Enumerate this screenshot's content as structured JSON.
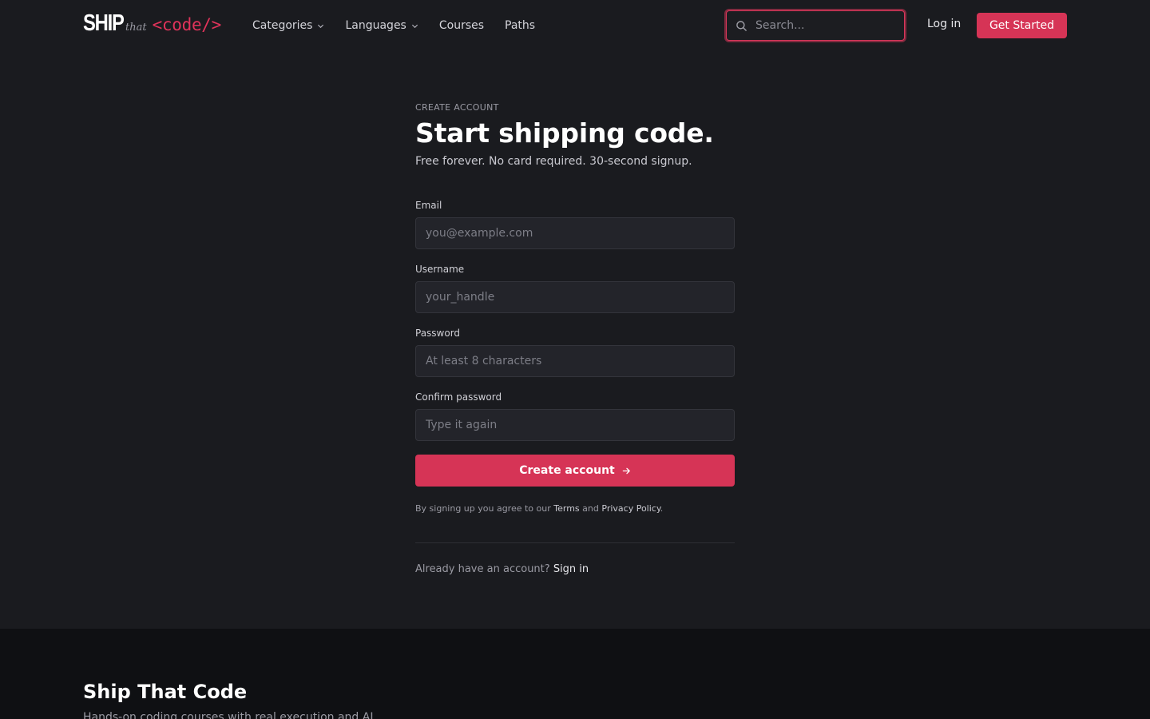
{
  "logo": {
    "ship": "SHIP",
    "that": "that",
    "code": "<code/>"
  },
  "nav": {
    "items": [
      {
        "label": "Categories",
        "dropdown": true
      },
      {
        "label": "Languages",
        "dropdown": true
      },
      {
        "label": "Courses",
        "dropdown": false
      },
      {
        "label": "Paths",
        "dropdown": false
      }
    ]
  },
  "search": {
    "placeholder": "Search...",
    "icon": "search-icon"
  },
  "header": {
    "login_label": "Log in",
    "get_started_label": "Get Started"
  },
  "form": {
    "eyebrow": "CREATE ACCOUNT",
    "title": "Start shipping code.",
    "subtitle": "Free forever. No card required. 30-second signup.",
    "fields": {
      "email": {
        "label": "Email",
        "placeholder": "you@example.com"
      },
      "username": {
        "label": "Username",
        "placeholder": "your_handle"
      },
      "password": {
        "label": "Password",
        "placeholder": "At least 8 characters"
      },
      "confirm": {
        "label": "Confirm password",
        "placeholder": "Type it again"
      }
    },
    "submit_label": "Create account",
    "legal_prefix": "By signing up you agree to our",
    "terms_label": "Terms",
    "legal_and": "and",
    "privacy_label": "Privacy Policy",
    "legal_suffix": ".",
    "signin_prompt": "Already have an account?",
    "signin_label": "Sign in"
  },
  "footer": {
    "title": "Ship That Code",
    "description": "Hands-on coding courses with real execution and AI"
  },
  "colors": {
    "background": "#1a1b1f",
    "accent": "#d63456",
    "footer_background": "#0f1013"
  }
}
